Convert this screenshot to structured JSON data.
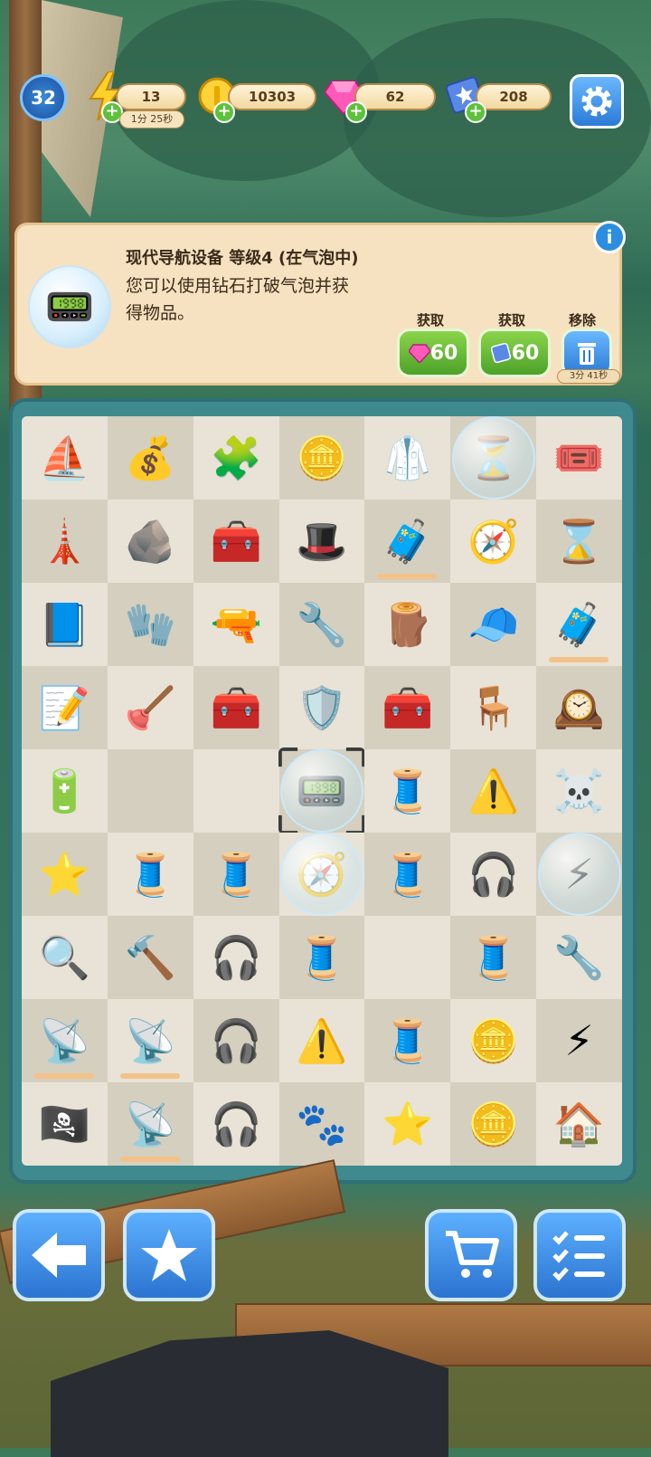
{
  "hud": {
    "level": "32",
    "energy": "13",
    "energy_timer": "1分 25秒",
    "coins": "10303",
    "gems": "62",
    "tickets": "208",
    "plus": "+"
  },
  "info": {
    "title": "现代导航设备 等级4 (在气泡中)",
    "desc": "您可以使用钻石打破气泡并获得物品。",
    "info_icon": "i",
    "buy_gem_label": "获取",
    "buy_gem_value": "60",
    "buy_ticket_label": "获取",
    "buy_ticket_value": "60",
    "remove_label": "移除",
    "remove_timer": "3分 41秒"
  },
  "board": {
    "rows": [
      [
        "⛵",
        "💰",
        "🧩",
        "🪙",
        "🥼",
        "⏳",
        "🎟️"
      ],
      [
        "🗼",
        "🪨",
        "🧰",
        "🎩",
        "🧳",
        "🧭",
        "⌛"
      ],
      [
        "📘",
        "🧤",
        "🔫",
        "🔧",
        "🪵",
        "🧢",
        "🧳"
      ],
      [
        "📝",
        "🪠",
        "🧰",
        "🛡️",
        "🧰",
        "🪑",
        "🕰️"
      ],
      [
        "🔋",
        "",
        "",
        "📟",
        "🧵",
        "⚠️",
        "☠️"
      ],
      [
        "⭐",
        "🧵",
        "🧵",
        "🧭",
        "🧵",
        "🎧",
        "⚡"
      ],
      [
        "🔍",
        "🔨",
        "🎧",
        "🧵",
        "",
        "🧵",
        "🔧"
      ],
      [
        "📡",
        "📡",
        "🎧",
        "⚠️",
        "🧵",
        "🪙",
        "⚡"
      ],
      [
        "🏴‍☠️",
        "📡",
        "🎧",
        "🐾",
        "⭐",
        "🪙",
        "🏠"
      ]
    ]
  },
  "icons": {
    "lightning": "lightning-icon",
    "coin": "coin-icon",
    "gem": "gem-icon",
    "ticket": "ticket-icon",
    "gear": "gear-icon",
    "back": "arrow-left-icon",
    "star": "star-icon",
    "cart": "cart-icon",
    "tasks": "checklist-icon",
    "trash": "trash-icon"
  },
  "colors": {
    "accent_blue": "#2b7bd6",
    "accent_green": "#5cc23a",
    "panel": "#f6e2c0",
    "board": "#3e8a8f"
  }
}
